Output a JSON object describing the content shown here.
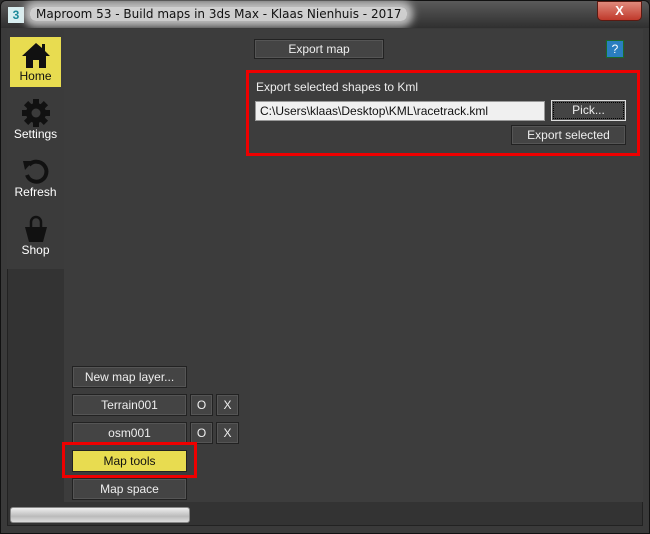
{
  "window": {
    "title": "Maproom 53 - Build maps in 3ds Max - Klaas Nienhuis - 2017",
    "app_icon": "3",
    "close_label": "X"
  },
  "sidebar": {
    "items": [
      {
        "label": "Home",
        "icon": "home-icon",
        "active": true
      },
      {
        "label": "Settings",
        "icon": "gear-icon"
      },
      {
        "label": "Refresh",
        "icon": "refresh-icon"
      },
      {
        "label": "Shop",
        "icon": "shopping-bag-icon"
      }
    ]
  },
  "layers": {
    "new_layer_label": "New map layer...",
    "items": [
      {
        "name": "Terrain001",
        "open_label": "O",
        "delete_label": "X"
      },
      {
        "name": "osm001",
        "open_label": "O",
        "delete_label": "X"
      }
    ],
    "map_tools_label": "Map tools",
    "map_space_label": "Map space"
  },
  "main": {
    "export_map_label": "Export map",
    "help_label": "?",
    "section_title": "Export selected shapes to Kml",
    "path_value": "C:\\Users\\klaas\\Desktop\\KML\\racetrack.kml",
    "pick_label": "Pick...",
    "export_selected_label": "Export selected"
  },
  "colors": {
    "accent": "#e8dc50",
    "highlight": "#ee0000",
    "help": "#2a7ec0"
  }
}
